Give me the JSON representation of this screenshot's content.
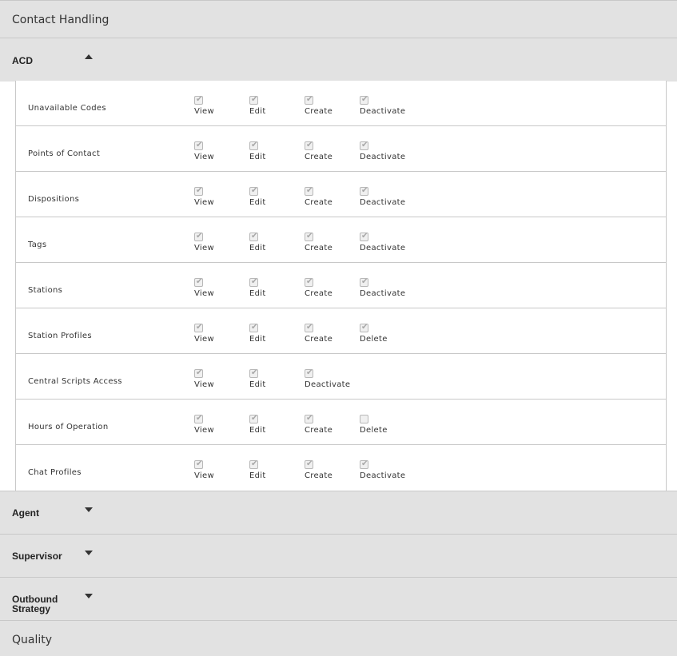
{
  "contact_handling": {
    "title": "Contact Handling"
  },
  "acd": {
    "title": "ACD",
    "expanded": true,
    "rows": [
      {
        "label": "Unavailable Codes",
        "permissions": [
          {
            "label": "View",
            "checked": true
          },
          {
            "label": "Edit",
            "checked": true
          },
          {
            "label": "Create",
            "checked": true
          },
          {
            "label": "Deactivate",
            "checked": true
          }
        ]
      },
      {
        "label": "Points of Contact",
        "permissions": [
          {
            "label": "View",
            "checked": true
          },
          {
            "label": "Edit",
            "checked": true
          },
          {
            "label": "Create",
            "checked": true
          },
          {
            "label": "Deactivate",
            "checked": true
          }
        ]
      },
      {
        "label": "Dispositions",
        "permissions": [
          {
            "label": "View",
            "checked": true
          },
          {
            "label": "Edit",
            "checked": true
          },
          {
            "label": "Create",
            "checked": true
          },
          {
            "label": "Deactivate",
            "checked": true
          }
        ]
      },
      {
        "label": "Tags",
        "permissions": [
          {
            "label": "View",
            "checked": true
          },
          {
            "label": "Edit",
            "checked": true
          },
          {
            "label": "Create",
            "checked": true
          },
          {
            "label": "Deactivate",
            "checked": true
          }
        ]
      },
      {
        "label": "Stations",
        "permissions": [
          {
            "label": "View",
            "checked": true
          },
          {
            "label": "Edit",
            "checked": true
          },
          {
            "label": "Create",
            "checked": true
          },
          {
            "label": "Deactivate",
            "checked": true
          }
        ]
      },
      {
        "label": "Station Profiles",
        "permissions": [
          {
            "label": "View",
            "checked": true
          },
          {
            "label": "Edit",
            "checked": true
          },
          {
            "label": "Create",
            "checked": true
          },
          {
            "label": "Delete",
            "checked": true
          }
        ]
      },
      {
        "label": "Central Scripts Access",
        "permissions": [
          {
            "label": "View",
            "checked": true
          },
          {
            "label": "Edit",
            "checked": true
          },
          {
            "label": "Deactivate",
            "checked": true
          }
        ]
      },
      {
        "label": "Hours of Operation",
        "permissions": [
          {
            "label": "View",
            "checked": true
          },
          {
            "label": "Edit",
            "checked": true
          },
          {
            "label": "Create",
            "checked": true
          },
          {
            "label": "Delete",
            "checked": false
          }
        ]
      },
      {
        "label": "Chat Profiles",
        "permissions": [
          {
            "label": "View",
            "checked": true
          },
          {
            "label": "Edit",
            "checked": true
          },
          {
            "label": "Create",
            "checked": true
          },
          {
            "label": "Deactivate",
            "checked": true
          }
        ]
      }
    ]
  },
  "collapsed_groups": [
    {
      "title": "Agent",
      "expanded": false
    },
    {
      "title": "Supervisor",
      "expanded": false
    },
    {
      "title": "Outbound Strategy",
      "expanded": false
    }
  ],
  "quality": {
    "title": "Quality"
  },
  "icons": {
    "expand": "caret-down-icon",
    "collapse": "caret-up-icon",
    "check": "checkmark-icon"
  }
}
